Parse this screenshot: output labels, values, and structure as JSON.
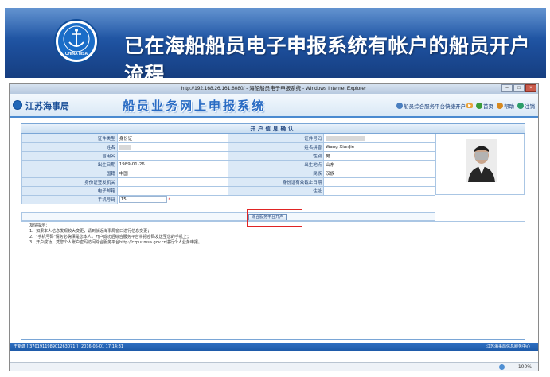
{
  "slide": {
    "title": "已在海船船员电子申报系统有帐户的船员开户流程",
    "logo_text": "CHINA MSA"
  },
  "browser": {
    "title": "http://192.168.26.161:8080/ - 海船船员电子申报系统 - Windows Internet Explorer",
    "zoom": "100%"
  },
  "site": {
    "org_name": "江苏海事局",
    "system_name": "船员业务网上申报系统",
    "links": {
      "portal": "船员综合服务平台快捷开户",
      "home": "首页",
      "help": "帮助",
      "logout": "注销"
    }
  },
  "form": {
    "title": "开户信息确认",
    "rows": [
      {
        "l1": "证件类型",
        "v1": "身份证",
        "l2": "证件号码",
        "v2": ""
      },
      {
        "l1": "姓名",
        "v1": "",
        "l2": "姓名拼音",
        "v2": "Wang XianJie"
      },
      {
        "l1": "曾用名",
        "v1": "",
        "l2": "性别",
        "v2": "男"
      },
      {
        "l1": "出生日期",
        "v1": "1989-01-26",
        "l2": "出生地点",
        "v2": "山东"
      },
      {
        "l1": "国籍",
        "v1": "中国",
        "l2": "民族",
        "v2": "汉族"
      },
      {
        "l1": "身份证签发机关",
        "v1": "",
        "l2": "身份证有效截止日期",
        "v2": ""
      },
      {
        "l1": "电子邮箱",
        "v1": "",
        "l2": "住址",
        "v2": ""
      }
    ],
    "phone_label": "手机号码",
    "phone_value": "15",
    "required_mark": "*",
    "apply_button": "综合服务平台开户",
    "notes": [
      "友情提示：",
      "1、如果本人信息发现较大变更，请到就近海事局窗口进行信息变更；",
      "2、\"手机号码\"请务必确保是您本人，开户成功后综合服务平台将把密码发送至您的手机上；",
      "3、开户成功，凭您个人账户密码访问综合服务平台http://czpur.msa.gov.cn进行个人业务申报。"
    ]
  },
  "status": {
    "user": "王新建 [ 370191198901263071 ]",
    "date": "2016-05-01 17:14:31",
    "corp": "江苏海事局信息服务中心"
  }
}
